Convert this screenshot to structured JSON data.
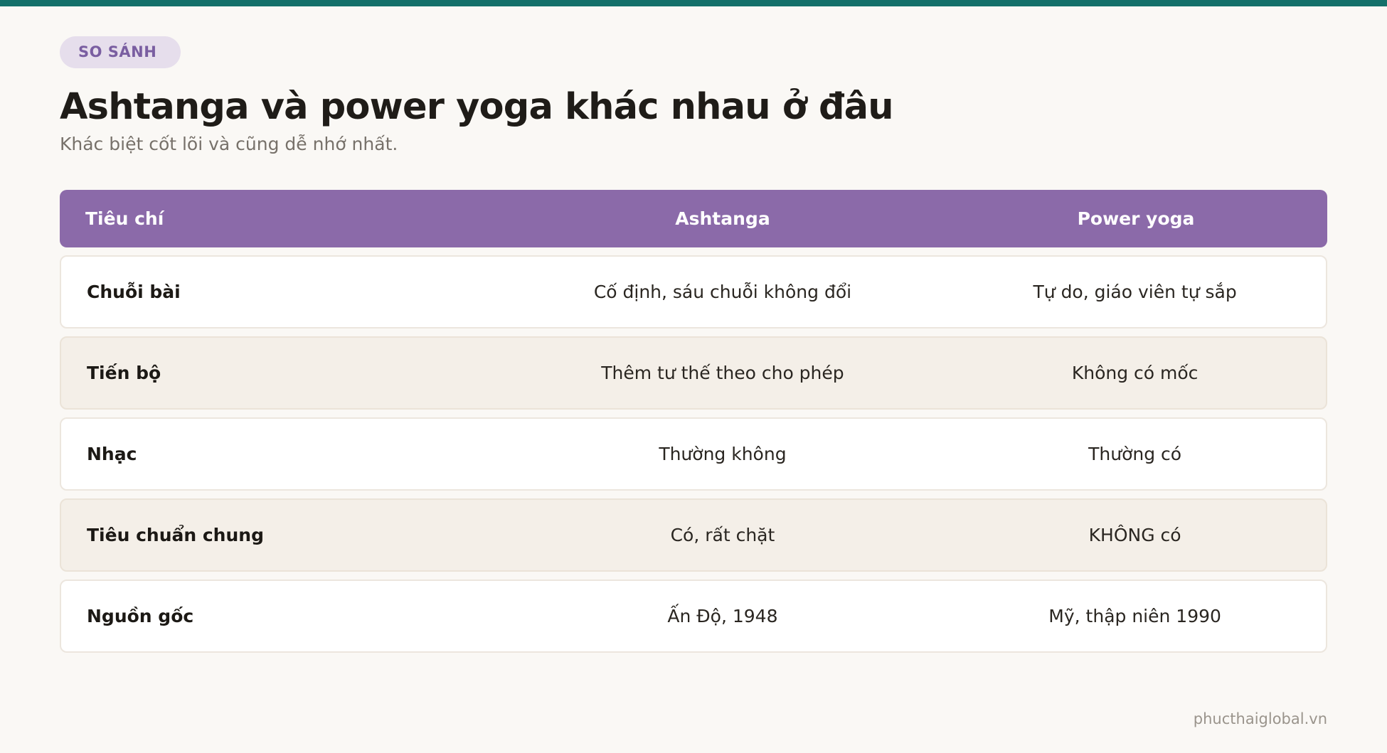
{
  "header": {
    "badge": "SO SÁNH",
    "title": "Ashtanga và power yoga khác nhau ở đâu",
    "subtitle": "Khác biệt cốt lõi và cũng dễ nhớ nhất."
  },
  "table": {
    "columns": [
      "Tiêu chí",
      "Ashtanga",
      "Power yoga"
    ],
    "rows": [
      [
        "Chuỗi bài",
        "Cố định, sáu chuỗi không đổi",
        "Tự do, giáo viên tự sắp"
      ],
      [
        "Tiến bộ",
        "Thêm tư thế theo cho phép",
        "Không có mốc"
      ],
      [
        "Nhạc",
        "Thường không",
        "Thường có"
      ],
      [
        "Tiêu chuẩn chung",
        "Có, rất chặt",
        "KHÔNG có"
      ],
      [
        "Nguồn gốc",
        "Ấn Độ, 1948",
        "Mỹ, thập niên 1990"
      ]
    ]
  },
  "footer": {
    "site": "phucthaiglobal.vn"
  },
  "colors": {
    "accent_bar": "#14706a",
    "header_purple": "#8b6aa9",
    "badge_bg": "#e6deec",
    "badge_text": "#7a5ea1",
    "row_alt": "#f4efe8"
  }
}
